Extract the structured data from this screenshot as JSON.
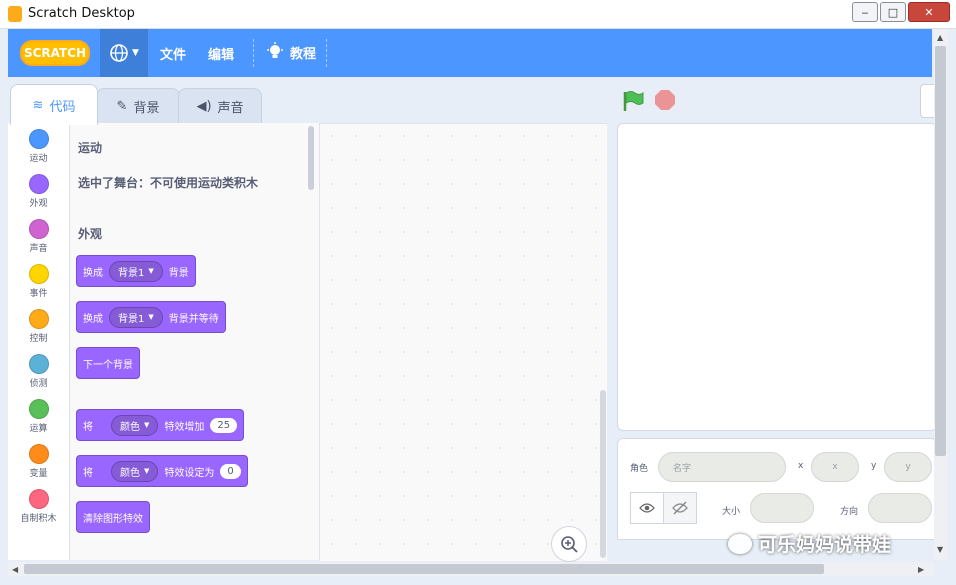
{
  "window": {
    "title": "Scratch Desktop",
    "minimize": "‒",
    "maximize": "□",
    "close": "✕"
  },
  "menubar": {
    "logo": "SCRATCH",
    "language_icon": "globe-icon",
    "file": "文件",
    "edit": "编辑",
    "tutorials": "教程"
  },
  "tabs": [
    {
      "label": "代码",
      "icon": "code-icon"
    },
    {
      "label": "背景",
      "icon": "brush-icon"
    },
    {
      "label": "声音",
      "icon": "speaker-icon"
    }
  ],
  "categories": [
    {
      "label": "运动",
      "color": "#4c97ff"
    },
    {
      "label": "外观",
      "color": "#9966ff"
    },
    {
      "label": "声音",
      "color": "#cf63cf"
    },
    {
      "label": "事件",
      "color": "#ffd500"
    },
    {
      "label": "控制",
      "color": "#ffab19"
    },
    {
      "label": "侦测",
      "color": "#5cb1d6"
    },
    {
      "label": "运算",
      "color": "#59c059"
    },
    {
      "label": "变量",
      "color": "#ff8c1a"
    },
    {
      "label": "自制积木",
      "color": "#ff6680"
    }
  ],
  "palette": {
    "motion_header": "运动",
    "motion_note": "选中了舞台：不可使用运动类积木",
    "looks_header": "外观",
    "blocks": [
      {
        "text": "换成",
        "dropdown": "背景1",
        "suffix": "背景"
      },
      {
        "text": "换成",
        "dropdown": "背景1",
        "suffix": "背景并等待"
      },
      {
        "text": "下一个背景"
      },
      {
        "text": "将",
        "dropdown": "颜色",
        "suffix": "特效增加",
        "value": "25"
      },
      {
        "text": "将",
        "dropdown": "颜色",
        "suffix": "特效设定为",
        "value": "0"
      },
      {
        "text": "清除图形特效"
      }
    ]
  },
  "sprite": {
    "label_sprite": "角色",
    "name_placeholder": "名字",
    "label_x": "x",
    "x_placeholder": "x",
    "label_y": "y",
    "y_placeholder": "y",
    "label_size": "大小",
    "label_direction": "方向"
  },
  "watermark": "可乐妈妈说带娃"
}
